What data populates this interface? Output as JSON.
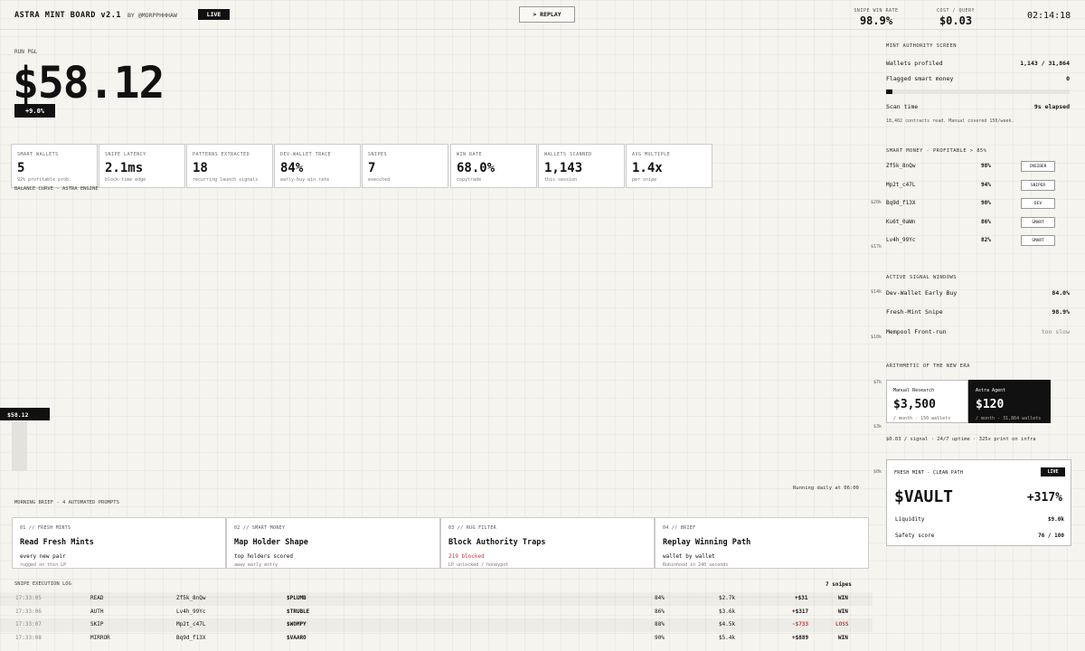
{
  "header": {
    "title": "ASTRA MINT BOARD v2.1",
    "byline": "BY @MORPPHHHAW",
    "live": "LIVE",
    "replay": "> REPLAY",
    "stats": [
      {
        "label": "SNIPE WIN RATE",
        "value": "98.9%"
      },
      {
        "label": "COST / QUERY",
        "value": "$0.03"
      }
    ],
    "clock": "02:14:18"
  },
  "hero": {
    "label": "RUN P&L",
    "value": "$58.12",
    "change": "+9.0%"
  },
  "stats": [
    {
      "label": "SMART WALLETS",
      "value": "5",
      "sub": "92% profitable prob."
    },
    {
      "label": "SNIPE LATENCY",
      "value": "2.1ms",
      "sub": "block-time edge"
    },
    {
      "label": "PATTERNS EXTRACTED",
      "value": "18",
      "sub": "recurring launch signals"
    },
    {
      "label": "DEV-WALLET TRACE",
      "value": "84%",
      "sub": "early-buy win rate"
    },
    {
      "label": "SNIPES",
      "value": "7",
      "sub": "executed"
    },
    {
      "label": "WIN RATE",
      "value": "68.0%",
      "sub": "copytrade"
    },
    {
      "label": "WALLETS SCANNED",
      "value": "1,143",
      "sub": "this session"
    },
    {
      "label": "AVG MULTIPLE",
      "value": "1.4x",
      "sub": "per snipe"
    }
  ],
  "chart": {
    "label": "BALANCE CURVE - ASTRA ENGINE",
    "y_ticks": [
      "$20k",
      "$17k",
      "$14k",
      "$10k",
      "$7k",
      "$3k",
      "$0k"
    ],
    "current": "$58.12",
    "running": "Running daily at 06:00"
  },
  "brief": {
    "title": "MORNING BRIEF - 4 AUTOMATED PROMPTS",
    "cards": [
      {
        "num": "01 // FRESH MINTS",
        "title": "Read Fresh Mints",
        "sub": "every new pair",
        "note": "rugged on thin LP",
        "red": false
      },
      {
        "num": "02 // SMART MONEY",
        "title": "Map Holder Shape",
        "sub": "top holders scored",
        "note": "away early entry",
        "red": false
      },
      {
        "num": "03 // RUG FILTER",
        "title": "Block Authority Traps",
        "sub": "219 blocked",
        "note": "LP unlocked / honeypot",
        "red": true
      },
      {
        "num": "04 // BRIEF",
        "title": "Replay Winning Path",
        "sub": "wallet by wallet",
        "note": "Robinhood in 240 seconds",
        "red": false
      }
    ]
  },
  "log": {
    "title": "SNIPE EXECUTION LOG",
    "count": "7 snipes",
    "rows": [
      {
        "time": "17:33:05",
        "action": "READ",
        "wallet": "Zf5k_8nQw",
        "token": "$PLUMB",
        "score": "84%",
        "size": "$2.7k",
        "pnl": "+$31",
        "result": "WIN"
      },
      {
        "time": "17:33:06",
        "action": "AUTH",
        "wallet": "Lv4h_99Yc",
        "token": "$TRUBLE",
        "score": "86%",
        "size": "$3.6k",
        "pnl": "+$317",
        "result": "WIN"
      },
      {
        "time": "17:33:07",
        "action": "SKIP",
        "wallet": "Mp2t_c47L",
        "token": "$WOMPY",
        "score": "88%",
        "size": "$4.5k",
        "pnl": "-$733",
        "result": "LOSS"
      },
      {
        "time": "17:33:08",
        "action": "MIRROR",
        "wallet": "Bq9d_f13X",
        "token": "$VAARO",
        "score": "90%",
        "size": "$5.4k",
        "pnl": "+$889",
        "result": "WIN"
      }
    ]
  },
  "screen": {
    "title": "MINT AUTHORITY SCREEN",
    "rows": [
      {
        "label": "Wallets profiled",
        "value": "1,143 / 31,864"
      },
      {
        "label": "Flagged smart money",
        "value": "0"
      }
    ],
    "progress": 0.036,
    "scan_label": "Scan time",
    "scan_value": "9s elapsed",
    "note": "18,402 contracts read. Manual covered 150/week."
  },
  "smart_money": {
    "title": "SMART MONEY - PROFITABLE > 85%",
    "rows": [
      {
        "wallet": "Zf5k_8nQw",
        "score": "98%",
        "tag": "INSIDER"
      },
      {
        "wallet": "Mp2t_c47L",
        "score": "94%",
        "tag": "SNIPER"
      },
      {
        "wallet": "Bq9d_f13X",
        "score": "90%",
        "tag": "DEV"
      },
      {
        "wallet": "Ku6t_0aWn",
        "score": "86%",
        "tag": "SMART"
      },
      {
        "wallet": "Lv4h_99Yc",
        "score": "82%",
        "tag": "SMART"
      }
    ]
  },
  "signals": {
    "title": "ACTIVE SIGNAL WINDOWS",
    "rows": [
      {
        "label": "Dev-Wallet Early Buy",
        "value": "84.0%",
        "muted": false
      },
      {
        "label": "Fresh-Mint Snipe",
        "value": "98.9%",
        "muted": false
      },
      {
        "label": "Mempool Front-run",
        "value": "too slow",
        "muted": true
      }
    ]
  },
  "arithmetic": {
    "title": "ARITHMETIC OF THE NEW ERA",
    "manual": {
      "label": "Manual Research",
      "value": "$3,500",
      "sub": "/ month - 150 wallets"
    },
    "agent": {
      "label": "Astra Agent",
      "value": "$120",
      "sub": "/ month - 31,864 wallets"
    },
    "foot": "$0.03 / signal  ·  24/7 uptime  ·  325x print on infra"
  },
  "fresh": {
    "label": "FRESH MINT - CLEAN PATH",
    "live": "LIVE",
    "ticker": "$VAULT",
    "change": "+317%",
    "rows": [
      {
        "label": "Liquidity",
        "value": "$9.0k"
      },
      {
        "label": "Safety score",
        "value": "76 / 100"
      }
    ]
  },
  "colors": {
    "background": "#f5f4ef",
    "ink": "#111111",
    "loss": "#c23b3b"
  }
}
